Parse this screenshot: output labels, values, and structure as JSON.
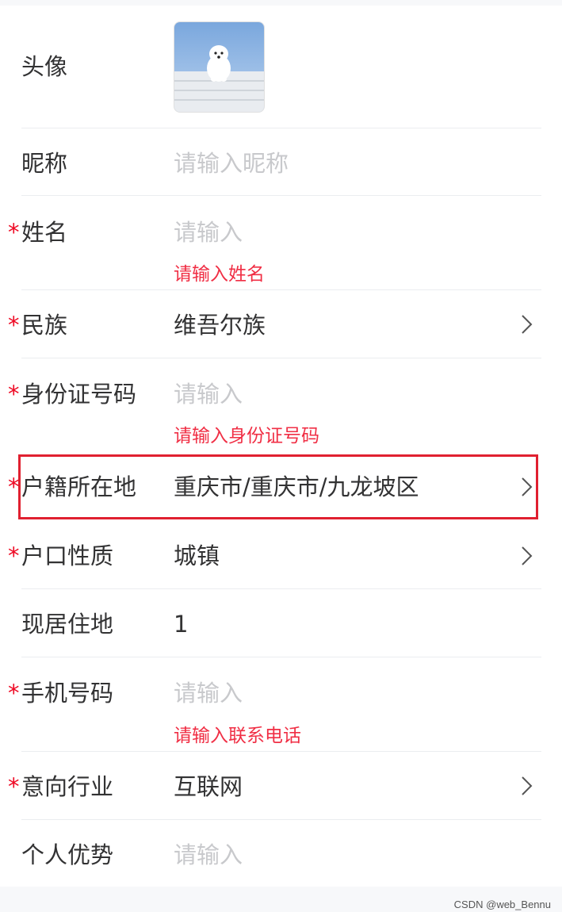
{
  "form": {
    "avatar": {
      "label": "头像",
      "icon": "dog-photo"
    },
    "nickname": {
      "label": "昵称",
      "placeholder": "请输入昵称"
    },
    "name": {
      "required": "*",
      "label": "姓名",
      "placeholder": "请输入",
      "error": "请输入姓名"
    },
    "ethnicity": {
      "required": "*",
      "label": "民族",
      "value": "维吾尔族"
    },
    "id_number": {
      "required": "*",
      "label": "身份证号码",
      "placeholder": "请输入",
      "error": "请输入身份证号码"
    },
    "household_location": {
      "required": "*",
      "label": "户籍所在地",
      "value": "重庆市/重庆市/九龙坡区"
    },
    "household_type": {
      "required": "*",
      "label": "户口性质",
      "value": "城镇"
    },
    "current_address": {
      "label": "现居住地",
      "value": "1"
    },
    "phone": {
      "required": "*",
      "label": "手机号码",
      "placeholder": "请输入",
      "error": "请输入联系电话"
    },
    "industry": {
      "required": "*",
      "label": "意向行业",
      "value": "互联网"
    },
    "advantages": {
      "label": "个人优势",
      "placeholder": "请输入"
    }
  },
  "watermark": "CSDN @web_Bennu",
  "colors": {
    "required": "#ee0a24",
    "placeholder": "#c8c9cc",
    "text": "#323233",
    "highlight": "#e02030"
  }
}
